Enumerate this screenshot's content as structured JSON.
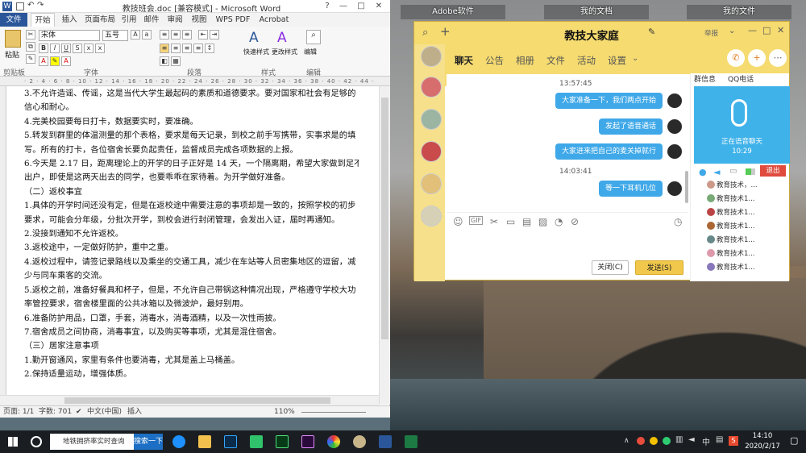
{
  "desktop": {
    "icons": [
      "Adobe软件",
      "我的文档",
      "我的文件"
    ]
  },
  "word": {
    "title": "教技班会.doc [兼容模式] - Microsoft Word",
    "tabs": [
      "文件",
      "开始",
      "插入",
      "页面布局",
      "引用",
      "邮件",
      "审阅",
      "视图",
      "WPS PDF",
      "Acrobat"
    ],
    "ribbon": {
      "paste_label": "粘贴",
      "clipboard_group": "剪贴板",
      "font_group": "字体",
      "paragraph_group": "段落",
      "style_group": "样式",
      "edit_group": "编辑",
      "font_name": "宋体",
      "font_size": "五号",
      "quick_style": "快速样式",
      "change_style": "更改样式",
      "edit_label": "编辑"
    },
    "doc_lines": [
      "3.不允许造谣、传谣，这是当代大学生最起码的素质和道德要求。要对国家和社会有足够的",
      "信心和耐心。",
      "4.完美校园要每日打卡，数据要实时，要准确。",
      "5.转发到群里的体温测量的那个表格，要求是每天记录，到校之前手写携带，实事求是的填",
      "写。所有的打卡，各位宿舍长要负起责任，监督成员完成各项数据的上报。",
      "6.今天是 2.17 日，距离理论上的开学的日子正好是 14 天，一个隔离期，希望大家做到足不",
      "出户，即使是这两天出去的同学，也要乖乖在家待着。为开学做好准备。",
      "（二）返校事宜",
      "1.具体的开学时间还没有定，但是在返校途中需要注意的事项却是一致的，按照学校的初步",
      "要求，可能会分年级，分批次开学，到校会进行封闭管理，会发出入证，届时再通知。",
      "2.没接到通知不允许返校。",
      "3.返校途中，一定做好防护，重中之重。",
      "4.返校过程中，请签记录路线以及乘坐的交通工具，减少在车站等人员密集地区的逗留，减",
      "少与同车乘客的交流。",
      "5.返校之前，准备好餐具和杯子，但是，不允许自己带锅这种情况出现，严格遵守学校大功",
      "率管控要求，宿舍楼里面的公共冰箱以及微波炉，最好别用。",
      "6.准备防护用品，口罩，手套，消毒水，消毒酒精，以及一次性雨披。",
      "7.宿舍成员之间协商，消毒事宜，以及购买等事项，尤其是混住宿舍。",
      "（三）居家注意事项",
      "1.勤开窗通风，家里有条件也要消毒，尤其是盖上马桶盖。",
      "2.保持适量运动，增强体质。"
    ],
    "status": {
      "page": "页面: 1/1",
      "words": "字数: 701",
      "lang": "中文(中国)",
      "mode": "插入",
      "zoom": "110%"
    }
  },
  "qq": {
    "title": "教技大家庭",
    "header_right": "举报",
    "tabs": [
      "聊天",
      "公告",
      "相册",
      "文件",
      "活动",
      "设置"
    ],
    "messages": [
      {
        "time": "13:57:45"
      },
      {
        "text": "大家准备一下，我们两点开始"
      },
      {
        "text": "发起了语音通话"
      },
      {
        "text": "大家进来把自己的麦关掉就行"
      },
      {
        "time": "14:03:41"
      },
      {
        "text": "等一下耳机几位"
      }
    ],
    "buttons": {
      "close": "关闭(C)",
      "send": "发送(S)"
    },
    "side": {
      "tabs": [
        "群信息",
        "QQ电话"
      ],
      "call_status": "正在语音聊天",
      "call_time": "10:29",
      "exit": "退出",
      "members": [
        "教育技术，...",
        "教育技术1...",
        "教育技术1...",
        "教育技术1...",
        "教育技术1...",
        "教育技术1...",
        "教育技术1..."
      ]
    }
  },
  "taskbar": {
    "search_text": "地铁拥挤率实时查询",
    "search_button": "搜索一下",
    "time": "14:10",
    "date": "2020/2/17",
    "ime": "中"
  }
}
